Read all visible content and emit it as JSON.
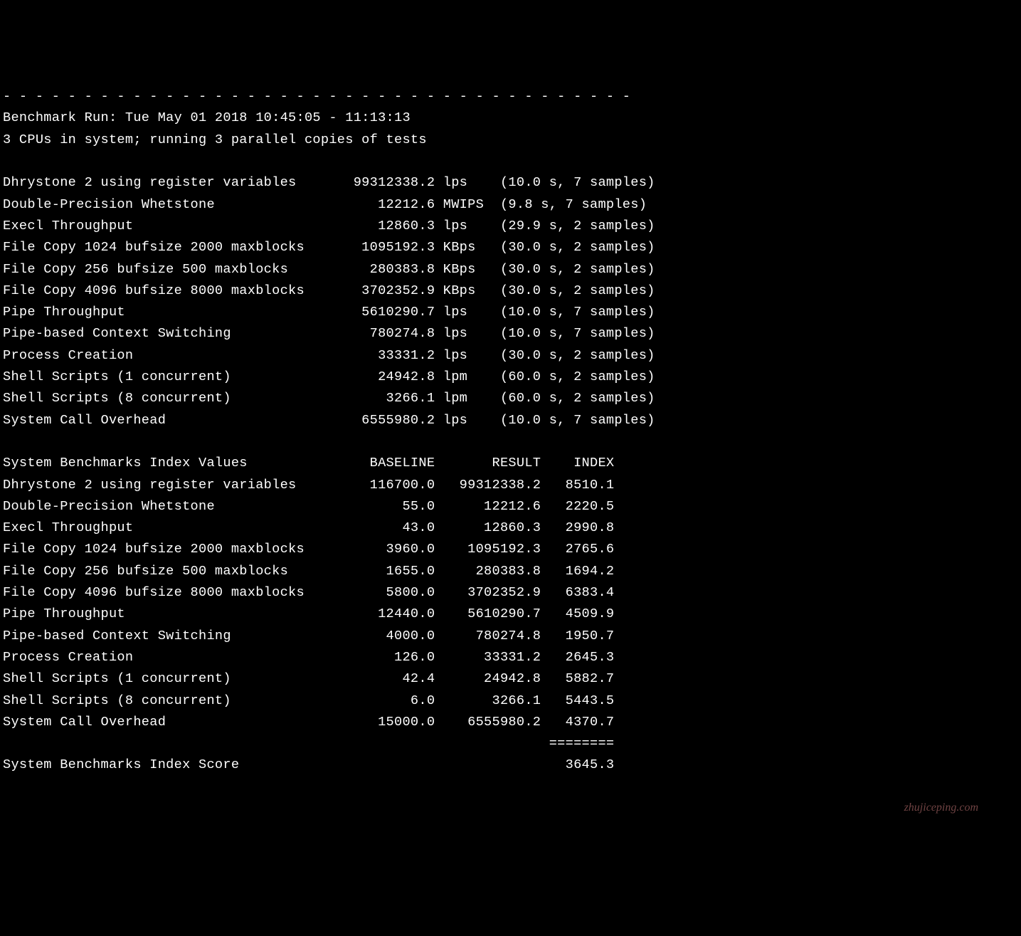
{
  "divider": "- - - - - - - - - - - - - - - - - - - - - - - - - - - - - - - - - - - - - - -",
  "run_line": "Benchmark Run: Tue May 01 2018 10:45:05 - 11:13:13",
  "cpu_line": "3 CPUs in system; running 3 parallel copies of tests",
  "tests": [
    {
      "name": "Dhrystone 2 using register variables",
      "value": "99312338.2",
      "unit": "lps",
      "detail": "(10.0 s, 7 samples)"
    },
    {
      "name": "Double-Precision Whetstone",
      "value": "12212.6",
      "unit": "MWIPS",
      "detail": "(9.8 s, 7 samples)"
    },
    {
      "name": "Execl Throughput",
      "value": "12860.3",
      "unit": "lps",
      "detail": "(29.9 s, 2 samples)"
    },
    {
      "name": "File Copy 1024 bufsize 2000 maxblocks",
      "value": "1095192.3",
      "unit": "KBps",
      "detail": "(30.0 s, 2 samples)"
    },
    {
      "name": "File Copy 256 bufsize 500 maxblocks",
      "value": "280383.8",
      "unit": "KBps",
      "detail": "(30.0 s, 2 samples)"
    },
    {
      "name": "File Copy 4096 bufsize 8000 maxblocks",
      "value": "3702352.9",
      "unit": "KBps",
      "detail": "(30.0 s, 2 samples)"
    },
    {
      "name": "Pipe Throughput",
      "value": "5610290.7",
      "unit": "lps",
      "detail": "(10.0 s, 7 samples)"
    },
    {
      "name": "Pipe-based Context Switching",
      "value": "780274.8",
      "unit": "lps",
      "detail": "(10.0 s, 7 samples)"
    },
    {
      "name": "Process Creation",
      "value": "33331.2",
      "unit": "lps",
      "detail": "(30.0 s, 2 samples)"
    },
    {
      "name": "Shell Scripts (1 concurrent)",
      "value": "24942.8",
      "unit": "lpm",
      "detail": "(60.0 s, 2 samples)"
    },
    {
      "name": "Shell Scripts (8 concurrent)",
      "value": "3266.1",
      "unit": "lpm",
      "detail": "(60.0 s, 2 samples)"
    },
    {
      "name": "System Call Overhead",
      "value": "6555980.2",
      "unit": "lps",
      "detail": "(10.0 s, 7 samples)"
    }
  ],
  "index_header": {
    "title": "System Benchmarks Index Values",
    "c1": "BASELINE",
    "c2": "RESULT",
    "c3": "INDEX"
  },
  "index_rows": [
    {
      "name": "Dhrystone 2 using register variables",
      "baseline": "116700.0",
      "result": "99312338.2",
      "index": "8510.1"
    },
    {
      "name": "Double-Precision Whetstone",
      "baseline": "55.0",
      "result": "12212.6",
      "index": "2220.5"
    },
    {
      "name": "Execl Throughput",
      "baseline": "43.0",
      "result": "12860.3",
      "index": "2990.8"
    },
    {
      "name": "File Copy 1024 bufsize 2000 maxblocks",
      "baseline": "3960.0",
      "result": "1095192.3",
      "index": "2765.6"
    },
    {
      "name": "File Copy 256 bufsize 500 maxblocks",
      "baseline": "1655.0",
      "result": "280383.8",
      "index": "1694.2"
    },
    {
      "name": "File Copy 4096 bufsize 8000 maxblocks",
      "baseline": "5800.0",
      "result": "3702352.9",
      "index": "6383.4"
    },
    {
      "name": "Pipe Throughput",
      "baseline": "12440.0",
      "result": "5610290.7",
      "index": "4509.9"
    },
    {
      "name": "Pipe-based Context Switching",
      "baseline": "4000.0",
      "result": "780274.8",
      "index": "1950.7"
    },
    {
      "name": "Process Creation",
      "baseline": "126.0",
      "result": "33331.2",
      "index": "2645.3"
    },
    {
      "name": "Shell Scripts (1 concurrent)",
      "baseline": "42.4",
      "result": "24942.8",
      "index": "5882.7"
    },
    {
      "name": "Shell Scripts (8 concurrent)",
      "baseline": "6.0",
      "result": "3266.1",
      "index": "5443.5"
    },
    {
      "name": "System Call Overhead",
      "baseline": "15000.0",
      "result": "6555980.2",
      "index": "4370.7"
    }
  ],
  "underline": "========",
  "score_label": "System Benchmarks Index Score",
  "score": "3645.3",
  "watermark": "zhujiceping.com"
}
